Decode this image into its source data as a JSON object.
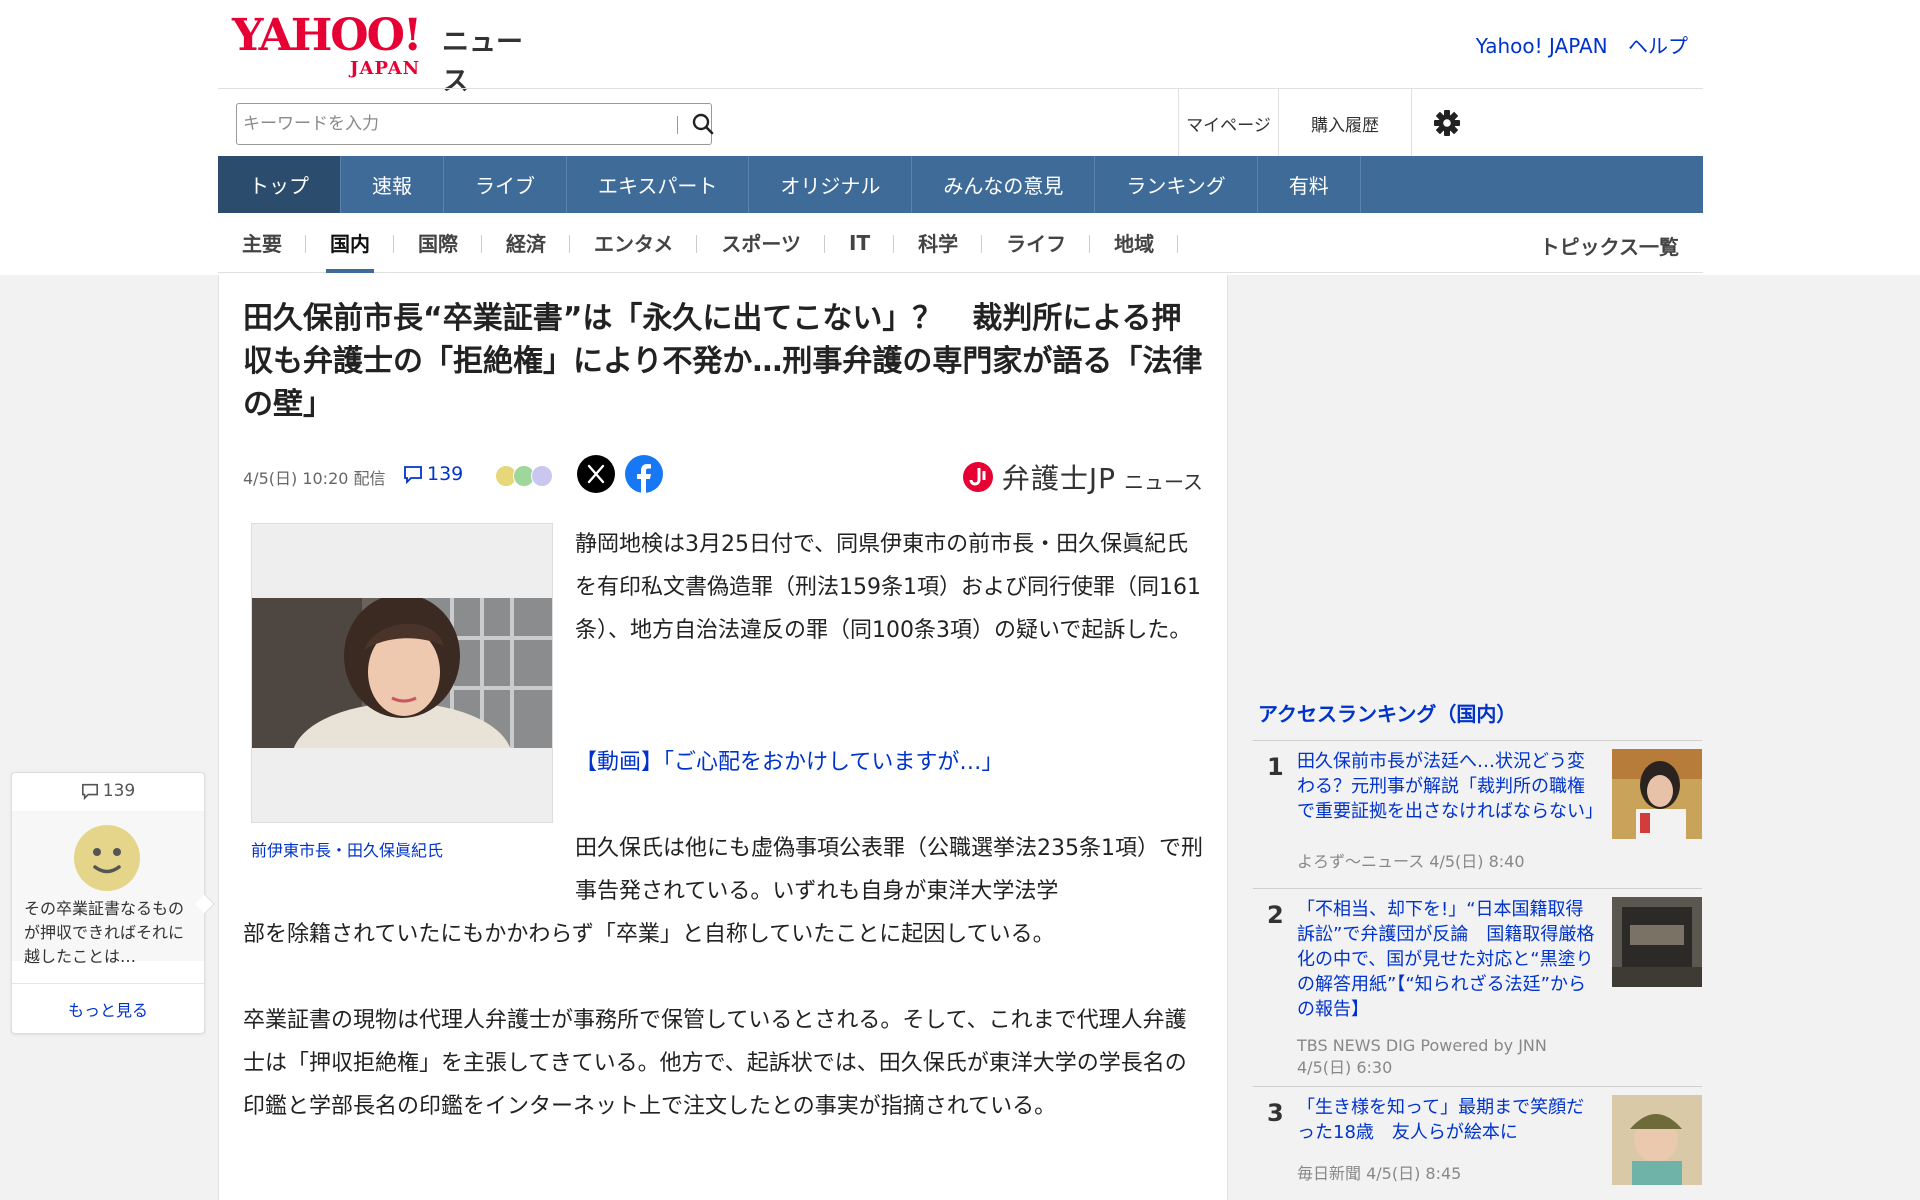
{
  "header": {
    "logo_text": "YAHOO!",
    "logo_sub": "JAPAN",
    "service": "ニュース",
    "links": [
      "Yahoo! JAPAN",
      "ヘルプ"
    ]
  },
  "search": {
    "placeholder": "キーワードを入力",
    "value": ""
  },
  "utility": {
    "mypage": "マイページ",
    "history": "購入履歴"
  },
  "nav": [
    "トップ",
    "速報",
    "ライブ",
    "エキスパート",
    "オリジナル",
    "みんなの意見",
    "ランキング",
    "有料"
  ],
  "subnav": [
    "主要",
    "国内",
    "国際",
    "経済",
    "エンタメ",
    "スポーツ",
    "IT",
    "科学",
    "ライフ",
    "地域"
  ],
  "subnav_topics": "トピックス一覧",
  "article": {
    "title": "田久保前市長“卒業証書”は「永久に出てこない」？　裁判所による押収も弁護士の「拒絶権」により不発か…刑事弁護の専門家が語る「法律の壁」",
    "date": "4/5(日) 10:20 配信",
    "comments": "139",
    "publisher_main": "弁護士JP",
    "publisher_sub": "ニュース",
    "caption": "前伊東市長・田久保眞紀氏",
    "lead": "静岡地検は3月25日付で、同県伊東市の前市長・田久保眞紀氏を有印私文書偽造罪（刑法159条1項）および同行使罪（同161条）、地方自治法違反の罪（同100条3項）の疑いで起訴した。",
    "video_link": "【動画】「ご心配をおかけしていますが…」",
    "p2a": "田久保氏は他にも虚偽事項公表罪（公職選挙法235条1項）で刑事告発されている。いずれも自身が東洋大学法学",
    "p2b": "部を除籍されていたにもかかわらず「卒業」と自称していたことに起因している。",
    "p3": "卒業証書の現物は代理人弁護士が事務所で保管しているとされる。そして、これまで代理人弁護士は「押収拒絶権」を主張してきている。他方で、起訴状では、田久保氏が東洋大学の学長名の印鑑と学部長名の印鑑をインターネット上で注文したとの事実が指摘されている。"
  },
  "ranking": {
    "title": "アクセスランキング（国内）",
    "items": [
      {
        "rank": "1",
        "title": "田久保前市長が法廷へ…状況どう変わる？元刑事が解説「裁判所の職権で重要証拠を出さなければならない」",
        "source": "よろず～ニュース 4/5(日) 8:40"
      },
      {
        "rank": "2",
        "title": "「不相当、却下を!」“日本国籍取得訴訟”で弁護団が反論　国籍取得厳格化の中で、国が見せた対応と“黒塗りの解答用紙”【“知られざる法廷”からの報告】",
        "source": "TBS NEWS DIG Powered by JNN 4/5(日) 6:30"
      },
      {
        "rank": "3",
        "title": "「生き様を知って」最期まで笑顔だった18歳　友人らが絵本に",
        "source": "毎日新聞 4/5(日) 8:45"
      }
    ]
  },
  "comment_card": {
    "count": "139",
    "text": "その卒業証書なるものが押収できればそれに越したことは…",
    "more": "もっと見る"
  },
  "colors": {
    "nav_bg": "#3f6b98",
    "nav_active": "#2c4c6e",
    "link": "#0033cc",
    "brand": "#e60033"
  }
}
